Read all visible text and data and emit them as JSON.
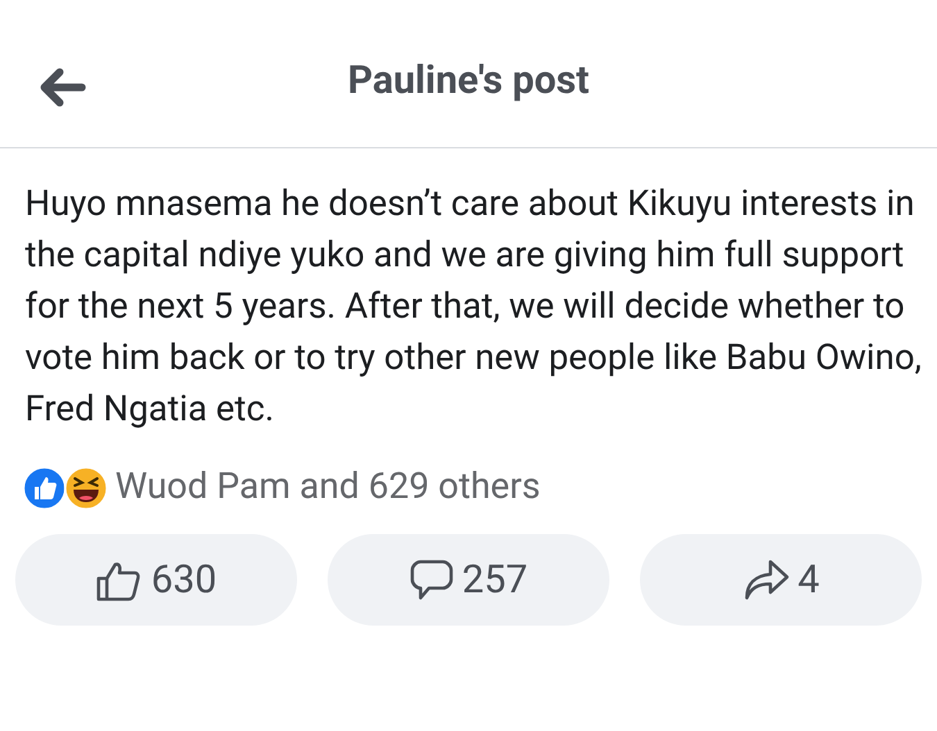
{
  "header": {
    "title": "Pauline's post"
  },
  "post": {
    "text": "Huyo mnasema he doesn’t care about Kikuyu interests in the capital ndiye yuko and we are giving him full support for the next 5 years. After that, we will decide whether to vote him back or to try other new people like Babu Owino, Fred Ngatia etc."
  },
  "reactions": {
    "summary": "Wuod Pam and 629 others"
  },
  "actions": [
    {
      "kind": "like",
      "count": "630"
    },
    {
      "kind": "comment",
      "count": "257"
    },
    {
      "kind": "share",
      "count": "4"
    }
  ]
}
